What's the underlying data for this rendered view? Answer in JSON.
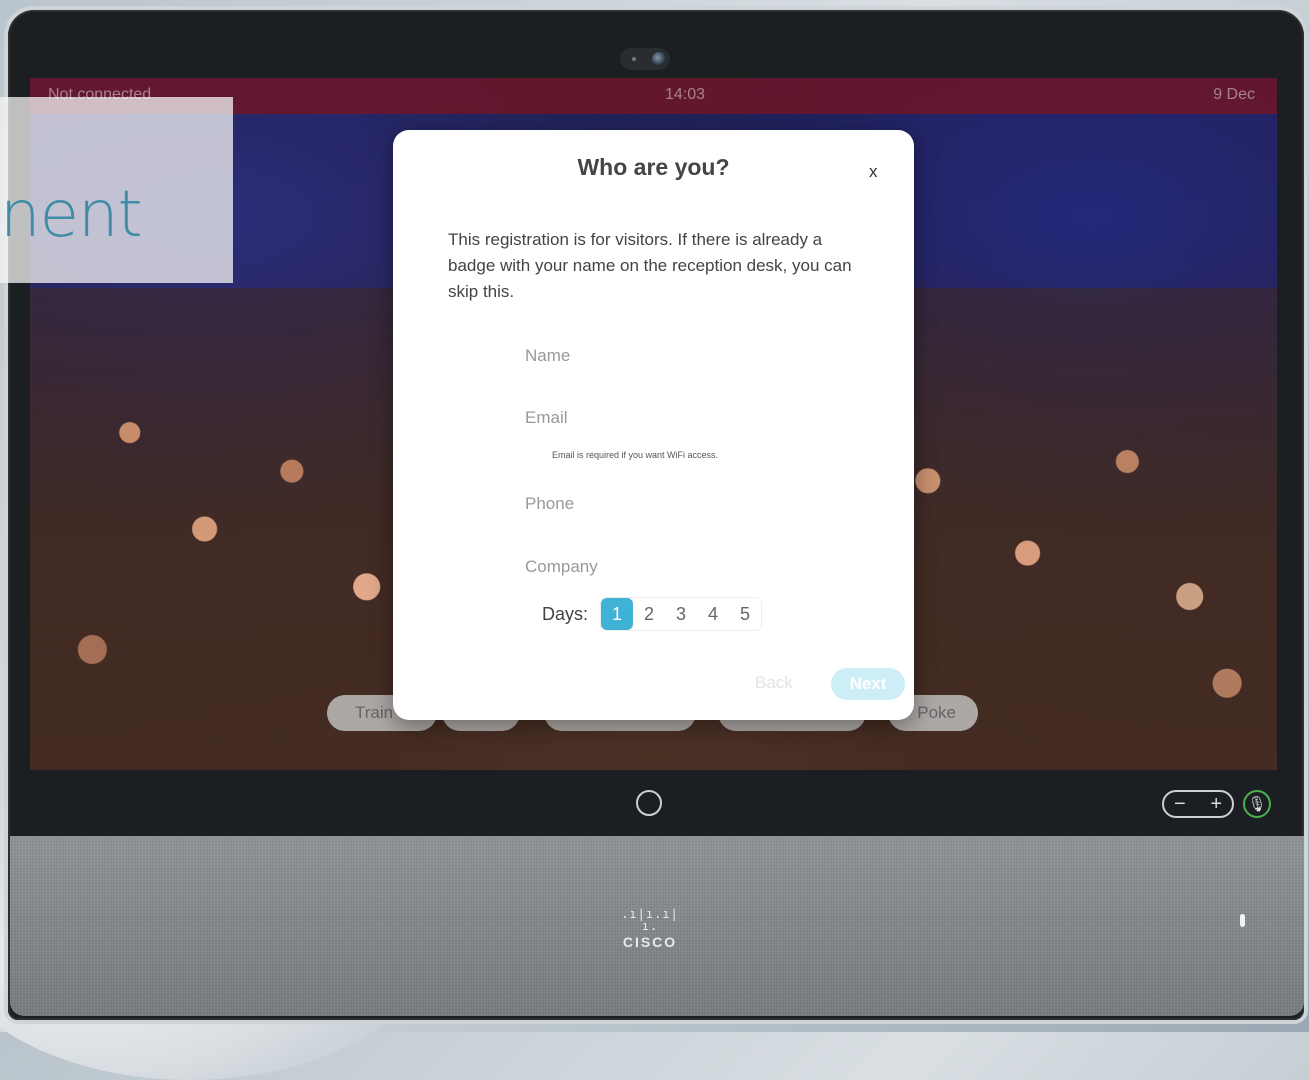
{
  "status_bar": {
    "connection": "Not connected",
    "time": "14:03",
    "date": "9 Dec"
  },
  "overlay": {
    "text": "nent"
  },
  "dialog": {
    "title": "Who are you?",
    "close": "x",
    "description": "This registration is for visitors. If there is already a badge with your name on the reception desk, you can skip this.",
    "fields": {
      "name_placeholder": "Name",
      "email_placeholder": "Email",
      "email_hint": "Email is required if you want WiFi access.",
      "phone_placeholder": "Phone",
      "company_placeholder": "Company"
    },
    "days_label": "Days:",
    "days": [
      "1",
      "2",
      "3",
      "4",
      "5"
    ],
    "selected_day": "1",
    "back_label": "Back",
    "next_label": "Next"
  },
  "bottom_buttons": {
    "train": "Train",
    "poke": "Poke"
  },
  "device": {
    "volume_minus": "−",
    "volume_plus": "+",
    "brand": "CISCO",
    "brand_bars": ".ı|ı.ı|ı."
  },
  "colors": {
    "accent": "#3fb2d6",
    "status_bar": "#78141e",
    "overlay_text": "#3f8ca7",
    "next_button": "#cdeef7"
  }
}
